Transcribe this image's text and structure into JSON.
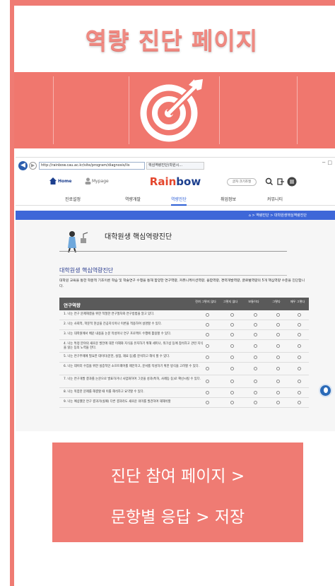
{
  "title": "역량 진단 페이지",
  "colors": {
    "accent": "#ef7b73",
    "brand_blue": "#1c3f8e",
    "nav_blue": "#3e67d8"
  },
  "icon": "target-arrow-icon",
  "browser": {
    "url": "http://rainbow.cau.ac.kr/site/program/diagnosis/lis",
    "tab_title": "핵심역량진단(학원시...",
    "window_controls": "−  □"
  },
  "site": {
    "home": "Home",
    "mypage": "Mypage",
    "brand_part1": "Rain",
    "brand_part2": "bow",
    "font_size_btn": "글자 크기조절",
    "nav": [
      "진로설정",
      "역량개발",
      "역량진단",
      "취업정보",
      "커뮤니티"
    ],
    "breadcrumb": "⌂  >  역량진단  >  대학원생핵심역량진단",
    "page_heading": "대학원생 핵심역량진단",
    "section_title": "대학원생 핵심역량진단",
    "description": "대학원 교육을 통한 학문적 기초이론 학습 및 학술연구 수행을 통해 함양한 연구역량, 커뮤니케이션역량, 융합역량, 경력개발역량, 글로벌역량의 5개 핵심역량 수준을 진단합니다.",
    "table": {
      "header": "연구역량",
      "options": [
        "전혀 그렇지 않다",
        "그렇지 않다",
        "보통이다",
        "그렇다",
        "매우 그렇다"
      ],
      "questions": [
        "1. 나는 연구 문제해결을 위한 적절한 연구절차와 연구방법을 알고 있다.",
        "2. 나는 사회적, 학문적 현상을 전공지식이나 이론을 적용하여 설명할 수 있다.",
        "3. 나는 대학원에서 배운 내용을 논문 작성이나 연구 프로젝트 수행에 활용할 수 있다.",
        "4. 나는 특정 분야의 새로운 발전에 대한 이해와 지식을 유지하기 위해 세미나, 워크샵 등에 참석하고 관련 지식을 읽는 등의 노력을 한다.",
        "5. 나는 연구주제에 필요한 데이터(문헌, 실험, 재료 등)를 분석하고 해석 할 수 있다.",
        "6. 나는 데이터 수집을 위한 실증적인 소프트웨어를 제안하고, 문서를 작성하기 위한 방식을 고려할 수 있다.",
        "7. 나는 연구개발 결과를 논문으로 발표하거나 사업화하여 그것을 성과(특허, 사례등 등)로 확산시킬 수 있다.",
        "8. 나는 복잡한 문제를 해결할 때 이를 해석하고 요약할 수 있다.",
        "9. 나는 예상했던 연구 결과가(실패) 다른 결과라도 새로운 의미를 발견하여 재해석할"
      ]
    }
  },
  "caption": {
    "line1": "진단 참여 페이지 >",
    "line2": "문항별 응답 > 저장"
  }
}
